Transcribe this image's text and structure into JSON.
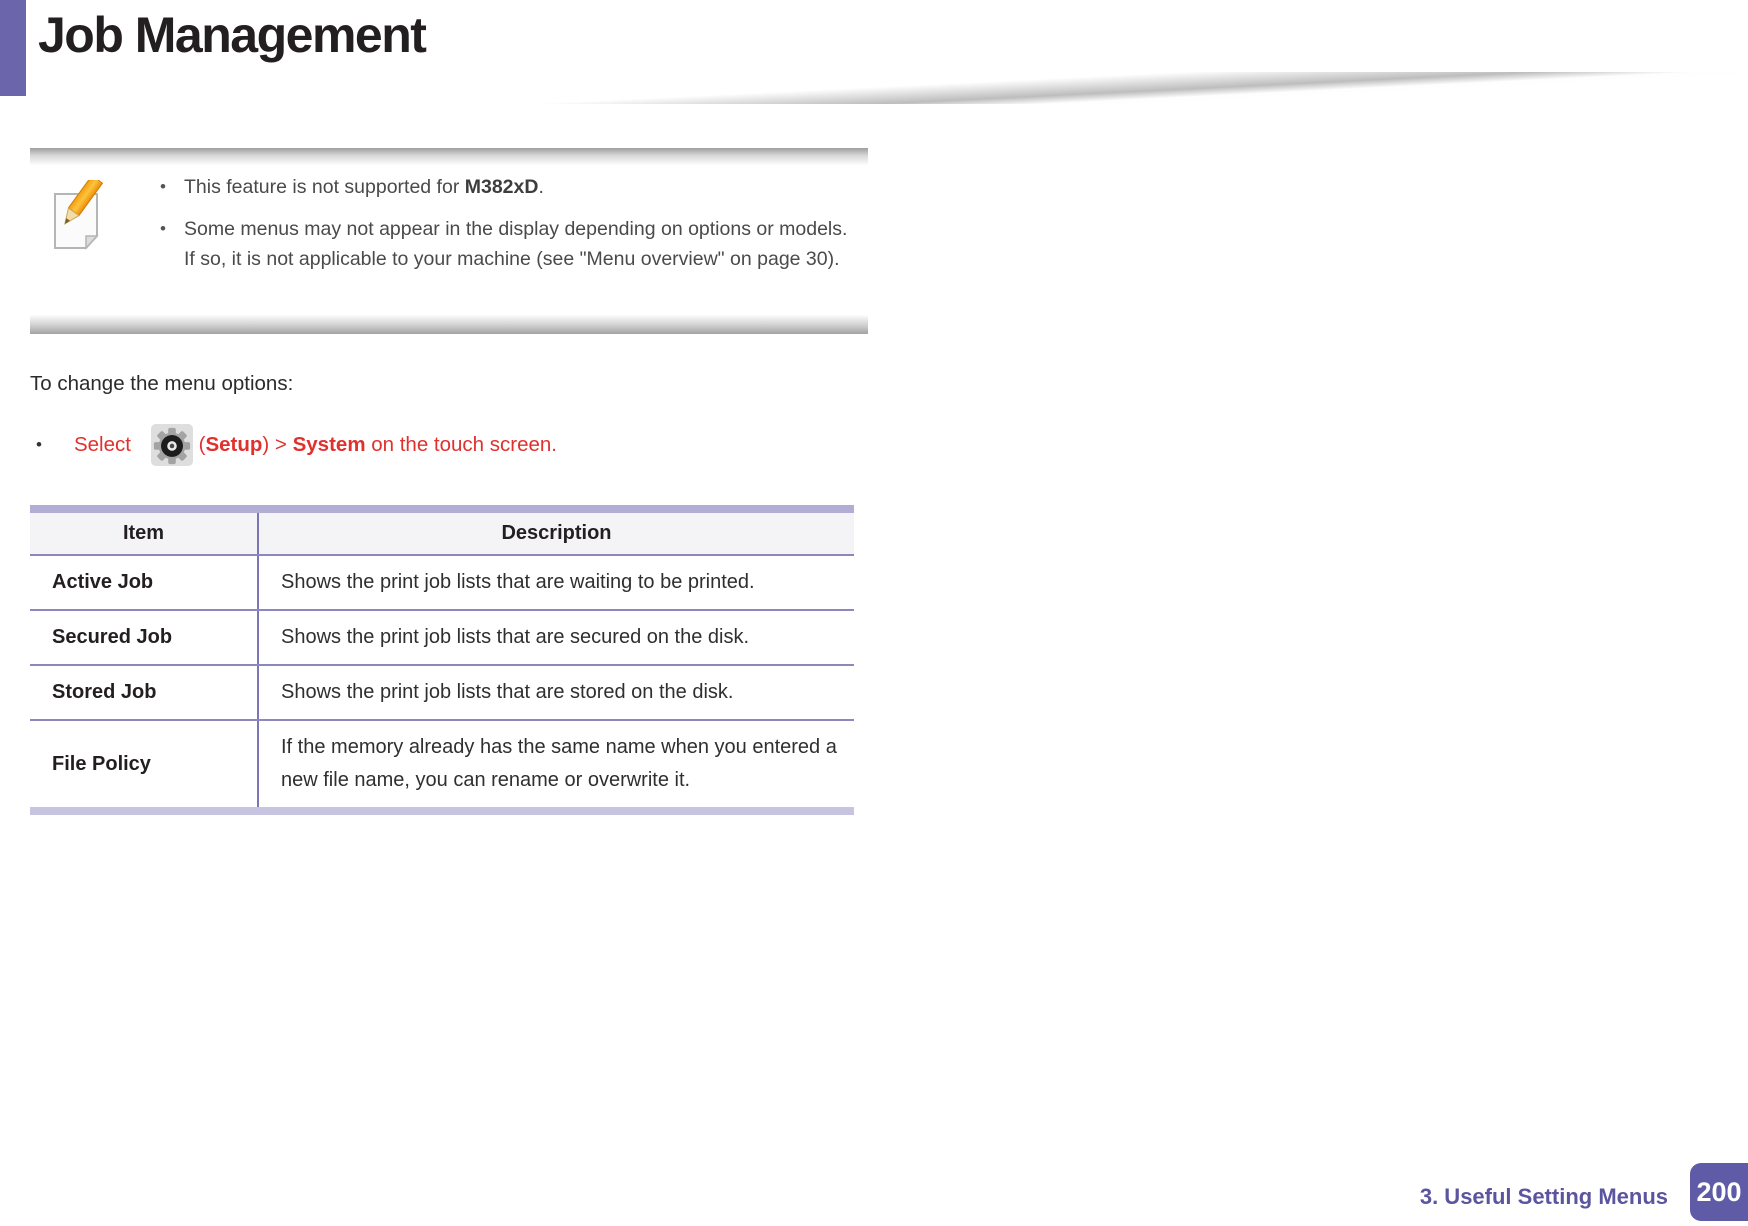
{
  "header": {
    "title": "Job Management"
  },
  "note": {
    "icon": "note-pencil-icon",
    "bullet_char": "•",
    "bullets": [
      {
        "pre": "This feature is not supported for ",
        "bold": "M382xD",
        "post": "."
      },
      {
        "pre": "Some menus may not appear in the display depending on options or models. If so, it is not applicable to your machine (see \"Menu overview\" on page 30).",
        "bold": "",
        "post": ""
      }
    ]
  },
  "intro": {
    "text": "To change the menu options:"
  },
  "select_step": {
    "bullet_char": "•",
    "icon": "setup-gear-icon",
    "part1": "Select ",
    "open_paren": "(",
    "setup_label": "Setup",
    "mid": ") > ",
    "system_label": "System",
    "tail": " on the touch screen."
  },
  "table": {
    "headers": {
      "item": "Item",
      "description": "Description"
    },
    "rows": [
      {
        "item": "Active Job",
        "description": "Shows the print job lists that are waiting to be printed."
      },
      {
        "item": "Secured Job",
        "description": "Shows the print job lists that are secured on the disk."
      },
      {
        "item": "Stored Job",
        "description": "Shows the print job lists that are stored on the disk."
      },
      {
        "item": "File Policy",
        "description": "If the memory already has the same name when you entered a new file name, you can rename or overwrite it."
      }
    ]
  },
  "footer": {
    "chapter": "3.  Useful Setting Menus",
    "page_number": "200"
  },
  "colors": {
    "accent_purple": "#6b65ac",
    "footer_purple": "#5b55a0",
    "page_box_purple": "#605ba6",
    "red_text": "#e0312e",
    "table_border_purple": "#8d87bf",
    "table_top_bar": "#b2add5",
    "table_bottom_bar": "#c7c4e2",
    "header_row_bg": "#f4f4f6"
  }
}
